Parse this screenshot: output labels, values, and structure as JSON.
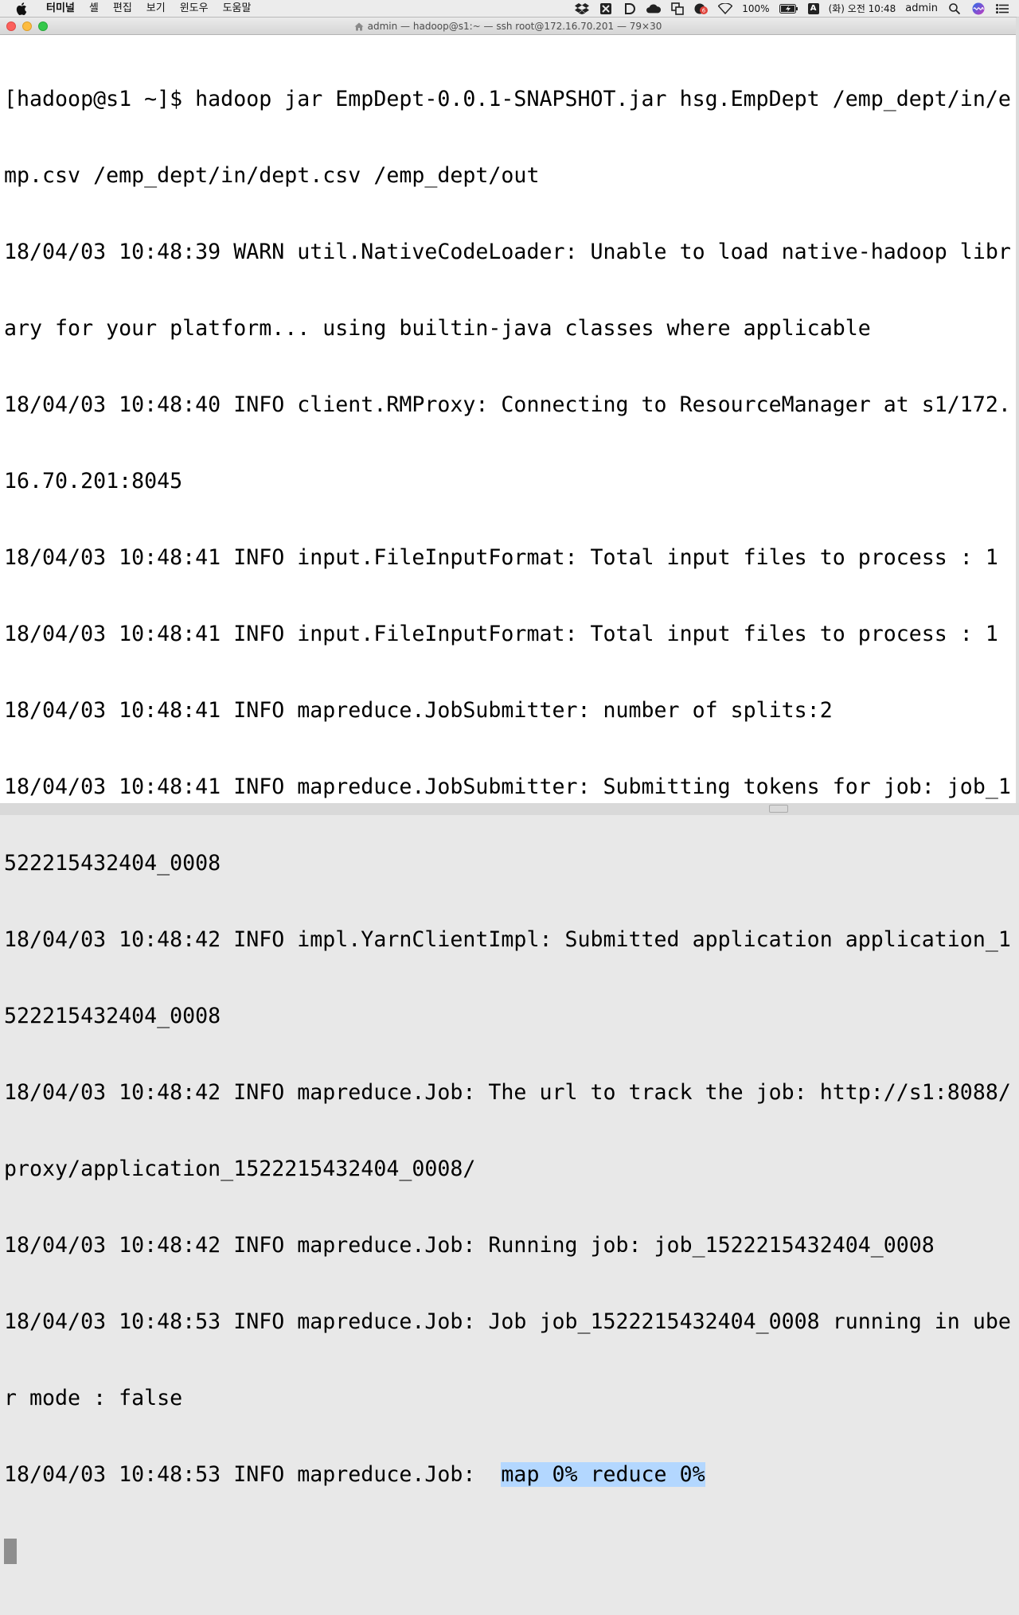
{
  "menubar": {
    "app_name": "터미널",
    "items": [
      "셸",
      "편집",
      "보기",
      "윈도우",
      "도움말"
    ],
    "battery": "100%",
    "input_source": "A",
    "clock": "(화) 오전 10:48",
    "user": "admin",
    "icons": [
      "apple-icon",
      "dropbox-icon",
      "grid-icon",
      "d-icon",
      "cloud-icon",
      "copy-icon",
      "notification-icon",
      "wifi-icon",
      "battery-icon",
      "spotlight-icon",
      "siri-icon",
      "list-icon"
    ]
  },
  "window": {
    "title": "admin — hadoop@s1:~ — ssh root@172.16.70.201 — 79×30",
    "lines": [
      "[hadoop@s1 ~]$ hadoop jar EmpDept-0.0.1-SNAPSHOT.jar hsg.EmpDept /emp_dept/in/e",
      "mp.csv /emp_dept/in/dept.csv /emp_dept/out",
      "18/04/03 10:48:39 WARN util.NativeCodeLoader: Unable to load native-hadoop libr",
      "ary for your platform... using builtin-java classes where applicable",
      "18/04/03 10:48:40 INFO client.RMProxy: Connecting to ResourceManager at s1/172.",
      "16.70.201:8045",
      "18/04/03 10:48:41 INFO input.FileInputFormat: Total input files to process : 1",
      "18/04/03 10:48:41 INFO input.FileInputFormat: Total input files to process : 1",
      "18/04/03 10:48:41 INFO mapreduce.JobSubmitter: number of splits:2",
      "18/04/03 10:48:41 INFO mapreduce.JobSubmitter: Submitting tokens for job: job_1",
      "522215432404_0008",
      "18/04/03 10:48:42 INFO impl.YarnClientImpl: Submitted application application_1",
      "522215432404_0008",
      "18/04/03 10:48:42 INFO mapreduce.Job: The url to track the job: http://s1:8088/",
      "proxy/application_1522215432404_0008/",
      "18/04/03 10:48:42 INFO mapreduce.Job: Running job: job_1522215432404_0008",
      "18/04/03 10:48:53 INFO mapreduce.Job: Job job_1522215432404_0008 running in ube",
      "r mode : false"
    ],
    "last_line_prefix": "18/04/03 10:48:53 INFO mapreduce.Job:  ",
    "last_line_highlight": "map 0% reduce 0%"
  }
}
